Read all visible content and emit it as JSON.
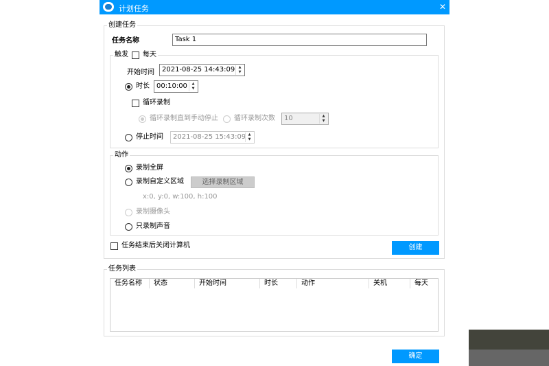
{
  "window": {
    "title": "计划任务",
    "close": "✕"
  },
  "create": {
    "legend": "创建任务",
    "name_label": "任务名称",
    "name_value": "Task 1",
    "trigger": {
      "legend": "触发",
      "daily": "每天",
      "start_label": "开始时间",
      "start_value": "2021-08-25 14:43:09",
      "duration_label": "时长",
      "duration_value": "00:10:00",
      "loop_label": "循环录制",
      "loop_until_stop": "循环录制直到手动停止",
      "loop_count_label": "循环录制次数",
      "loop_count_value": "10",
      "stop_label": "停止时间",
      "stop_value": "2021-08-25 15:43:09"
    },
    "action": {
      "legend": "动作",
      "fullscreen": "录制全屏",
      "custom": "录制自定义区域",
      "select_area": "选择录制区域",
      "region": "x:0, y:0, w:100, h:100",
      "camera": "录制摄像头",
      "audio_only": "只录制声音"
    },
    "shutdown": "任务结束后关闭计算机",
    "create_btn": "创建"
  },
  "list": {
    "legend": "任务列表",
    "columns": [
      "任务名称",
      "状态",
      "开始时间",
      "时长",
      "动作",
      "关机",
      "每天"
    ]
  },
  "ok_btn": "确定",
  "colors": {
    "accent": "#0099ff"
  }
}
